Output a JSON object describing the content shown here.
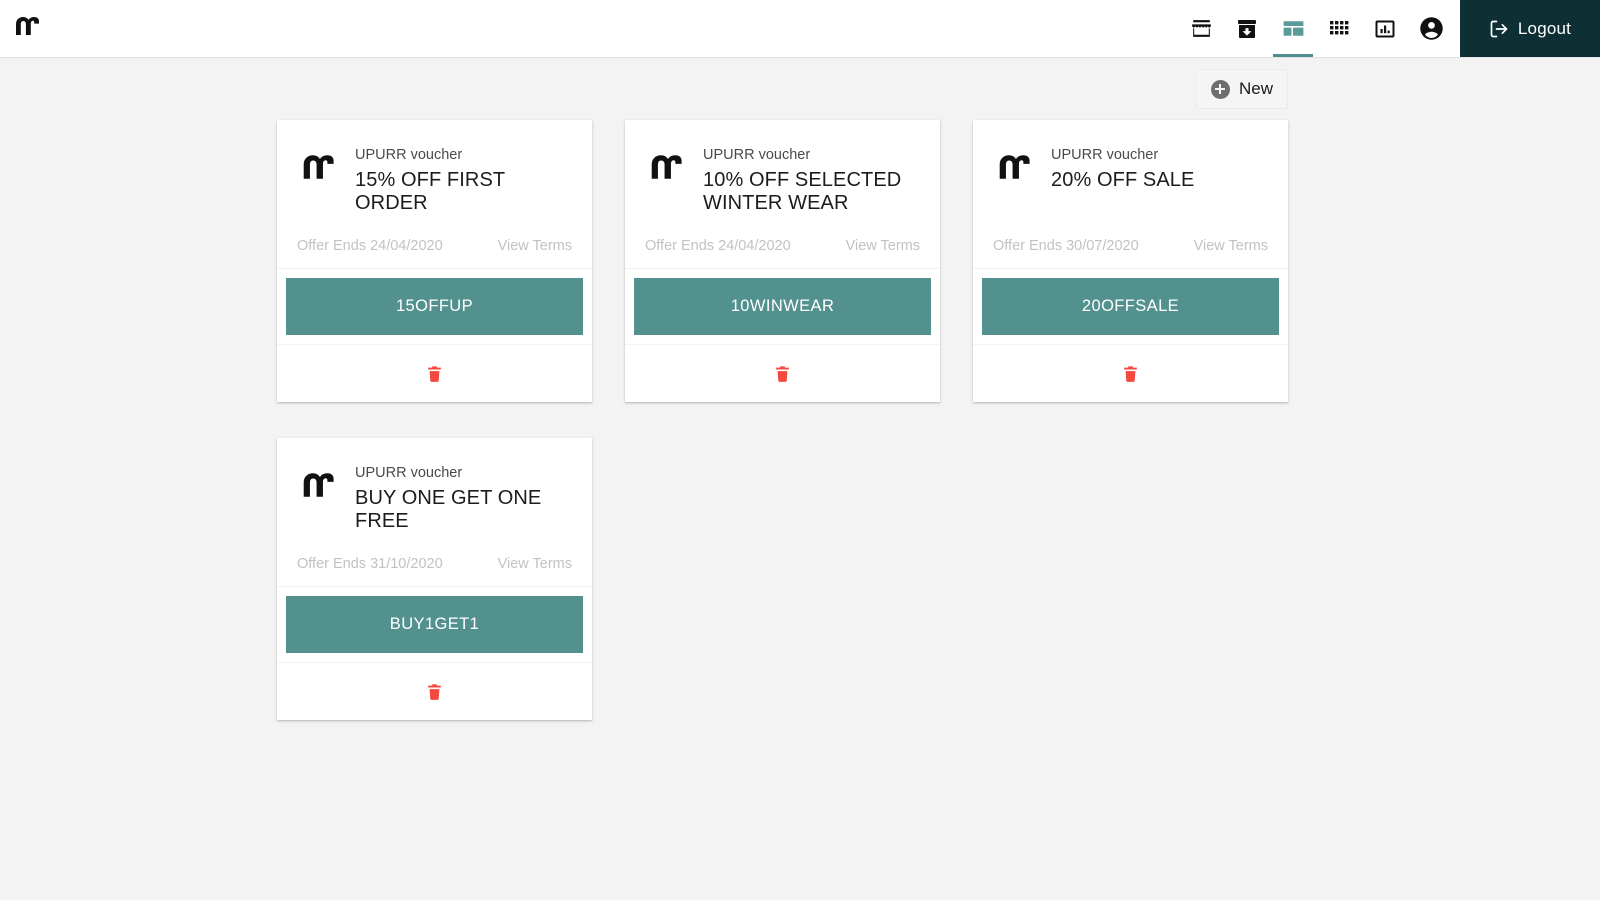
{
  "header": {
    "brand_logo_icon": "upurr-logo-mark",
    "nav_items": [
      {
        "icon": "storefront-icon",
        "label": "Storefront",
        "active": false
      },
      {
        "icon": "archive-download-icon",
        "label": "Orders",
        "active": false
      },
      {
        "icon": "dashboard-layout-icon",
        "label": "Vouchers",
        "active": true
      },
      {
        "icon": "grid-apps-icon",
        "label": "Products",
        "active": false
      },
      {
        "icon": "bar-chart-icon",
        "label": "Analytics",
        "active": false
      },
      {
        "icon": "account-circle-icon",
        "label": "Account",
        "active": false
      }
    ],
    "logout": {
      "label": "Logout",
      "icon": "logout-icon"
    },
    "colors": {
      "logout_background": "#0e3034",
      "active_tab": "#4f908e",
      "header_background": "#ffffff"
    }
  },
  "toolbar": {
    "new_label": "New",
    "new_icon": "plus-circle-icon"
  },
  "page": {
    "background": "#f3f3f3",
    "card_background": "#ffffff",
    "code_button_color": "#53918f",
    "delete_icon_color": "#f4493f"
  },
  "labels": {
    "view_terms": "View Terms",
    "delete_icon": "trash-delete-icon",
    "brand_mark_icon": "upurr-logo-mark"
  },
  "vouchers": [
    {
      "kicker": "UPURR voucher",
      "title": "15% OFF FIRST ORDER",
      "expiry": "Offer Ends 24/04/2020",
      "terms": "View Terms",
      "code": "15OFFUP"
    },
    {
      "kicker": "UPURR voucher",
      "title": "10% OFF SELECTED WINTER WEAR",
      "expiry": "Offer Ends 24/04/2020",
      "terms": "View Terms",
      "code": "10WINWEAR"
    },
    {
      "kicker": "UPURR voucher",
      "title": "20% OFF SALE",
      "expiry": "Offer Ends 30/07/2020",
      "terms": "View Terms",
      "code": "20OFFSALE"
    },
    {
      "kicker": "UPURR voucher",
      "title": "BUY ONE GET ONE FREE",
      "expiry": "Offer Ends 31/10/2020",
      "terms": "View Terms",
      "code": "BUY1GET1"
    }
  ]
}
